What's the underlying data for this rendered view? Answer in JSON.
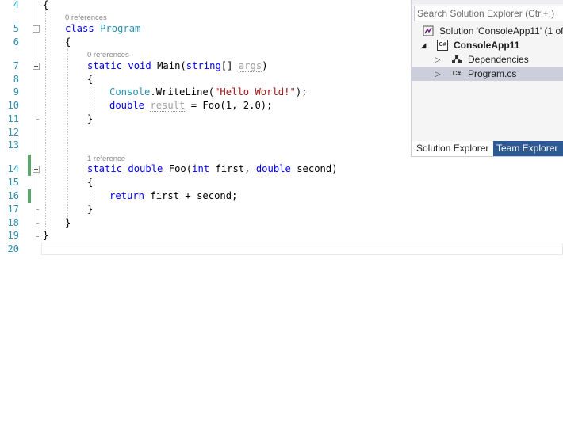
{
  "editor": {
    "line_numbers": [
      "4",
      "5",
      "6",
      "7",
      "8",
      "9",
      "10",
      "11",
      "12",
      "13",
      "14",
      "15",
      "16",
      "17",
      "18",
      "19",
      "20"
    ],
    "codelens": {
      "class_refs": "0 references",
      "main_refs": "0 references",
      "foo_refs": "1 reference"
    },
    "code": {
      "l4_brace": "{",
      "l5_kw": "class",
      "l5_name": "Program",
      "l6_brace": "{",
      "l7_static": "static",
      "l7_void": "void",
      "l7_main": "Main(",
      "l7_string": "string",
      "l7_arr": "[]",
      "l7_args": "args",
      "l7_close": ")",
      "l8_brace": "{",
      "l9_console": "Console",
      "l9_call": ".WriteLine(",
      "l9_str": "\"Hello World!\"",
      "l9_end": ");",
      "l10_double": "double",
      "l10_result": "result",
      "l10_rest": " = Foo(1, 2.0);",
      "l11_brace": "}",
      "l14_static": "static",
      "l14_double": "double",
      "l14_foo": "Foo(",
      "l14_int": "int",
      "l14_first": " first, ",
      "l14_double2": "double",
      "l14_second": " second)",
      "l15_brace": "{",
      "l16_return": "return",
      "l16_expr": " first + second;",
      "l17_brace": "}",
      "l18_brace": "}",
      "l19_brace": "}"
    }
  },
  "solution_explorer": {
    "search_placeholder": "Search Solution Explorer (Ctrl+;)",
    "items": [
      {
        "label": "Solution 'ConsoleApp11' (1 of",
        "icon": "solution-icon"
      },
      {
        "label": "ConsoleApp11",
        "icon": "csharp-project-icon"
      },
      {
        "label": "Dependencies",
        "icon": "dependencies-icon"
      },
      {
        "label": "Program.cs",
        "icon": "csharp-file-icon"
      }
    ],
    "project_icon_text": "C#",
    "file_icon_text": "C#",
    "tabs": {
      "solution_explorer": "Solution Explorer",
      "team_explorer": "Team Explorer"
    }
  },
  "colors": {
    "keyword": "#0000ff",
    "type": "#2b91af",
    "string": "#a31515",
    "line_number": "#2b91af",
    "change_bar": "#59a869",
    "tab_inactive_bg": "#2d5a95"
  }
}
